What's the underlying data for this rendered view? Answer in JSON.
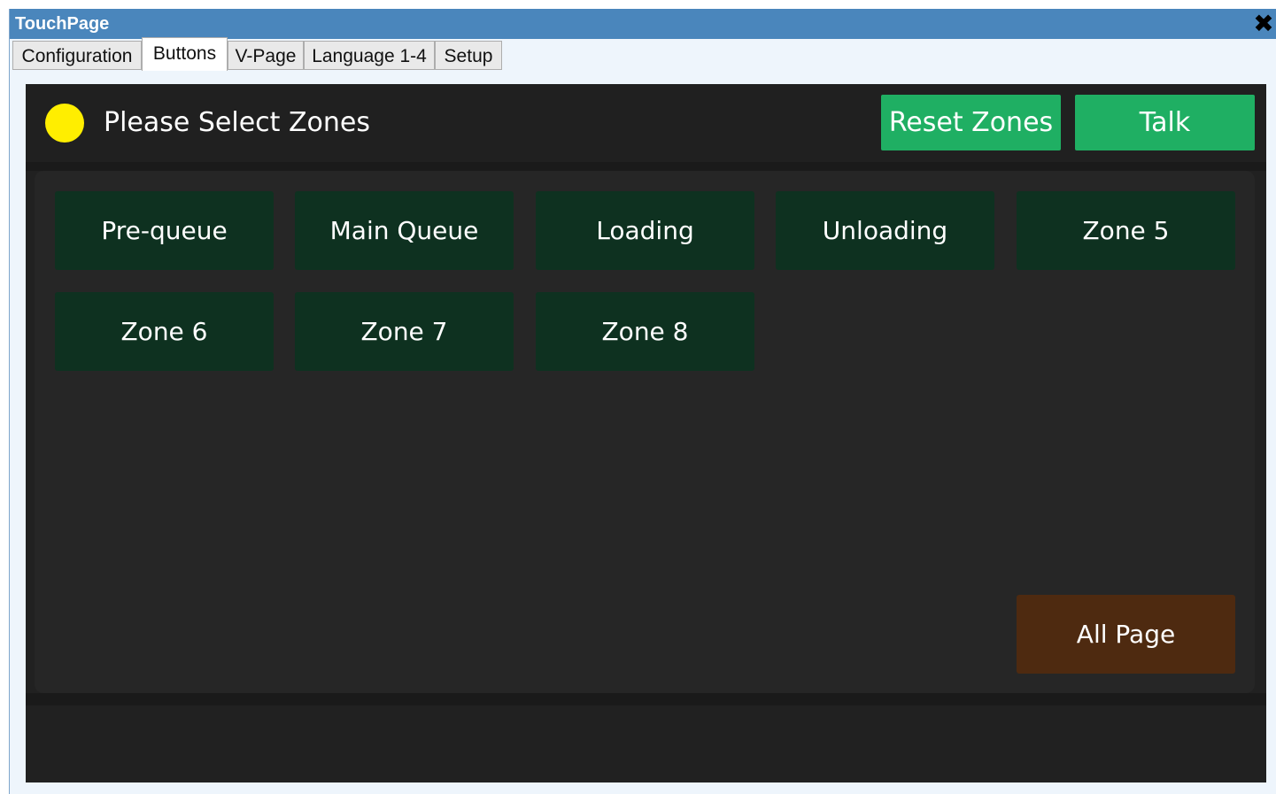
{
  "window": {
    "title": "TouchPage",
    "close_glyph": "✖"
  },
  "tabs": [
    {
      "label": "Configuration",
      "active": false
    },
    {
      "label": "Buttons",
      "active": true
    },
    {
      "label": "V-Page",
      "active": false
    },
    {
      "label": "Language 1-4",
      "active": false
    },
    {
      "label": "Setup",
      "active": false
    }
  ],
  "header": {
    "status_color": "#ffee00",
    "prompt": "Please Select Zones",
    "reset_label": "Reset Zones",
    "talk_label": "Talk"
  },
  "zones": [
    {
      "label": "Pre-queue"
    },
    {
      "label": "Main Queue"
    },
    {
      "label": "Loading"
    },
    {
      "label": "Unloading"
    },
    {
      "label": "Zone 5"
    },
    {
      "label": "Zone 6"
    },
    {
      "label": "Zone 7"
    },
    {
      "label": "Zone 8"
    }
  ],
  "all_page_label": "All Page",
  "colors": {
    "accent_green": "#1faf63",
    "zone_bg": "#0e3120",
    "all_page_bg": "#4e2a10",
    "titlebar": "#4a86bc"
  }
}
